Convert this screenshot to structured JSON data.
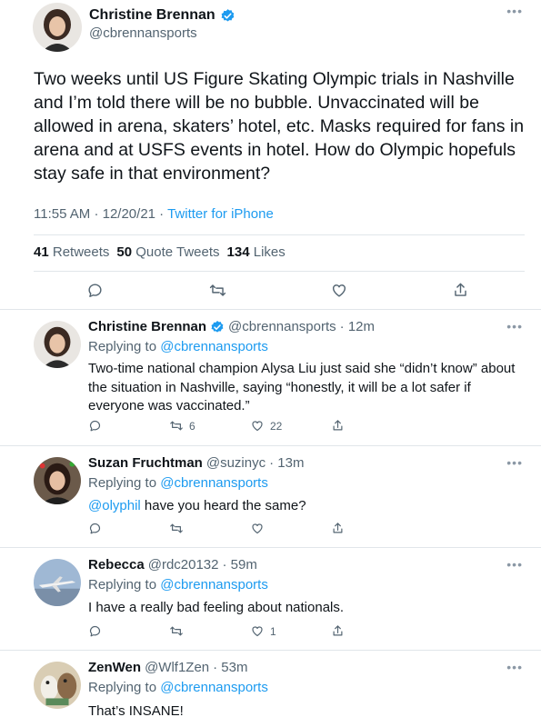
{
  "main_tweet": {
    "author": {
      "name": "Christine Brennan",
      "handle": "@cbrennansports",
      "verified": true
    },
    "text": "Two weeks until US Figure Skating Olympic trials in Nashville and I’m told there will be no bubble. Unvaccinated will be allowed in arena, skaters’ hotel, etc. Masks required for fans in arena and at USFS events in hotel. How do Olympic hopefuls stay safe in that environment?",
    "time": "11:55 AM",
    "sep1": "·",
    "date": "12/20/21",
    "sep2": "·",
    "source": "Twitter for iPhone",
    "stats": {
      "retweets_count": "41",
      "retweets_label": "Retweets",
      "quotes_count": "50",
      "quotes_label": "Quote Tweets",
      "likes_count": "134",
      "likes_label": "Likes"
    },
    "more_icon": "ellipsis-icon"
  },
  "replies": [
    {
      "name": "Christine Brennan",
      "verified": true,
      "handle": "@cbrennansports",
      "time": "· 12m",
      "replying_prefix": "Replying to ",
      "replying_to": "@cbrennansports",
      "text": "Two-time national champion Alysa Liu just said she “didn’t know” about the situation in Nashville, saying “honestly, it will be a lot safer if everyone was vaccinated.”",
      "retweets": "6",
      "likes": "22"
    },
    {
      "name": "Suzan Fruchtman",
      "verified": false,
      "handle": "@suzinyc",
      "time": "· 13m",
      "replying_prefix": "Replying to ",
      "replying_to": "@cbrennansports",
      "mention": "@olyphil",
      "text": " have you heard the same?",
      "retweets": "",
      "likes": ""
    },
    {
      "name": "Rebecca",
      "verified": false,
      "handle": "@rdc20132",
      "time": "· 59m",
      "replying_prefix": "Replying to ",
      "replying_to": "@cbrennansports",
      "text": "I have a really bad feeling about nationals.",
      "retweets": "",
      "likes": "1"
    },
    {
      "name": "ZenWen",
      "verified": false,
      "handle": "@Wlf1Zen",
      "time": "· 53m",
      "replying_prefix": "Replying to ",
      "replying_to": "@cbrennansports",
      "text": "That’s INSANE!",
      "retweets": "",
      "likes": ""
    }
  ],
  "colors": {
    "link": "#1d9bf0",
    "secondary_text": "#536471",
    "verified": "#1d9bf0",
    "divider": "#e1e6ea"
  },
  "icons": [
    "reply-icon",
    "retweet-icon",
    "like-icon",
    "share-icon",
    "verified-badge-icon",
    "ellipsis-icon"
  ]
}
